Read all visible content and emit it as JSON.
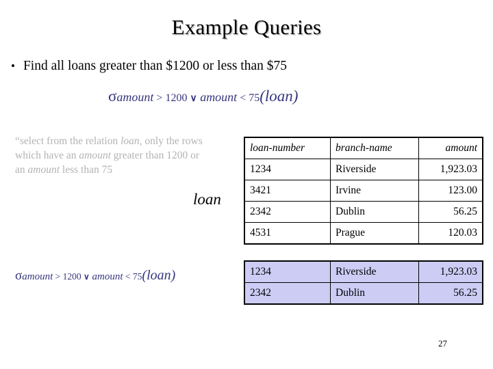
{
  "slide": {
    "title": "Example Queries",
    "page_number": "27"
  },
  "bullet": {
    "marker": "•",
    "text": "Find all loans greater than $1200 or less than $75"
  },
  "formula": {
    "sigma": "σ",
    "subscript_part1": "amount",
    "operator1": " > ",
    "value1": "1200 ",
    "or_symbol": "∨",
    "subscript_part2": " amount",
    "operator2": " < ",
    "value2": "75",
    "relation": "(loan)",
    "full_text": "σ amount > 1200 ∨ amount < 75 (loan)"
  },
  "description": {
    "segment1": "“select from the relation ",
    "italic1": "loan",
    "segment2": ", only the rows which have an ",
    "italic2": "amount",
    "segment3": " greater than 1200 or an ",
    "italic3": "amount",
    "segment4": " less than 75"
  },
  "loan_caption": "loan",
  "loan_table": {
    "headers": [
      "loan-number",
      "branch-name",
      "amount"
    ],
    "rows": [
      [
        "1234",
        "Riverside",
        "1,923.03"
      ],
      [
        "3421",
        "Irvine",
        "123.00"
      ],
      [
        "2342",
        "Dublin",
        "56.25"
      ],
      [
        "4531",
        "Prague",
        "120.03"
      ]
    ]
  },
  "result_table": {
    "rows": [
      [
        "1234",
        "Riverside",
        "1,923.03"
      ],
      [
        "2342",
        "Dublin",
        "56.25"
      ]
    ],
    "fill_color": "#ccccf5"
  },
  "colors": {
    "formula_navy": "#36367e",
    "description_gray": "#b3b3b3",
    "result_fill": "#ccccf5",
    "background": "#ffffff"
  }
}
